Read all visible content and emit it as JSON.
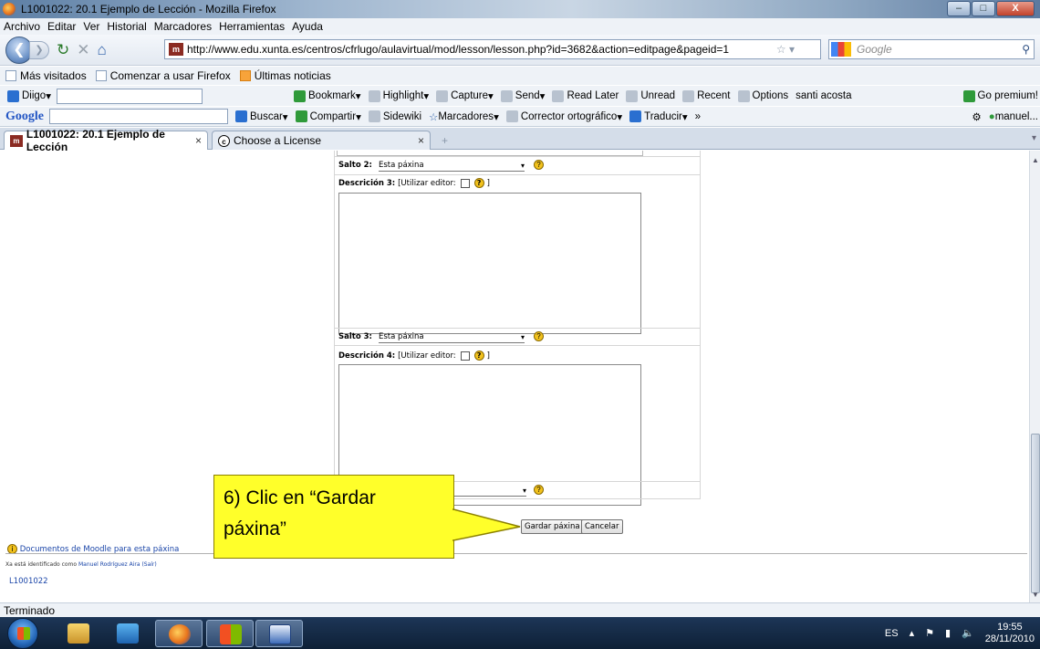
{
  "window": {
    "title": "L1001022: 20.1 Ejemplo de Lección - Mozilla Firefox",
    "min": "–",
    "max": "□",
    "close": "X"
  },
  "menu": [
    "Archivo",
    "Editar",
    "Ver",
    "Historial",
    "Marcadores",
    "Herramientas",
    "Ayuda"
  ],
  "nav": {
    "url": "http://www.edu.xunta.es/centros/cfrlugo/aulavirtual/mod/lesson/lesson.php?id=3682&action=editpage&pageid=1",
    "site_icon": "m",
    "search_placeholder": "Google"
  },
  "bookmarks": [
    "Más visitados",
    "Comenzar a usar Firefox",
    "Últimas noticias"
  ],
  "toolbar1": {
    "diigo": "Diigo",
    "items": [
      "Bookmark",
      "Highlight",
      "Capture",
      "Send",
      "Read Later",
      "Unread",
      "Recent",
      "Options",
      "santi acosta"
    ],
    "go_premium": "Go premium!"
  },
  "toolbar2": {
    "google": "Google",
    "items": [
      "Buscar",
      "Compartir",
      "Sidewiki",
      "Marcadores",
      "Corrector ortográfico",
      "Traducir",
      "»"
    ],
    "user": "manuel..."
  },
  "tabs": [
    {
      "label": "L1001022: 20.1 Ejemplo de Lección",
      "close": "×"
    },
    {
      "label": "Choose a License",
      "close": "×"
    }
  ],
  "form": {
    "salto2_label": "Salto 2:",
    "salto2_value": "Esta páxina",
    "desc3_label": "Descrición 3:",
    "desc3_editor_pre": "[Utilizar editor:",
    "desc3_editor_post": "]",
    "salto3_label": "Salto 3:",
    "salto3_value": "Esta páxina",
    "desc4_label": "Descrición 4:",
    "desc4_editor_pre": "[Utilizar editor:",
    "desc4_editor_post": "]",
    "help": "?",
    "save_button": "Gardar páxina",
    "cancel_button": "Cancelar"
  },
  "footer": {
    "moodle_docs": "Documentos de Moodle para esta páxina",
    "identified_prefix": "Xa está identificado como",
    "identified_user": "Manuel Rodríguez Aira",
    "identified_logout": "(Saír)",
    "course": "L1001022"
  },
  "callout": {
    "line1": "6) Clic en “Gardar",
    "line2": "páxina”"
  },
  "status": "Terminado",
  "tray": {
    "lang": "ES",
    "time": "19:55",
    "date": "28/11/2010"
  },
  "colors": {
    "callout_fill": "#ffff2a",
    "link": "#1a45a8"
  }
}
